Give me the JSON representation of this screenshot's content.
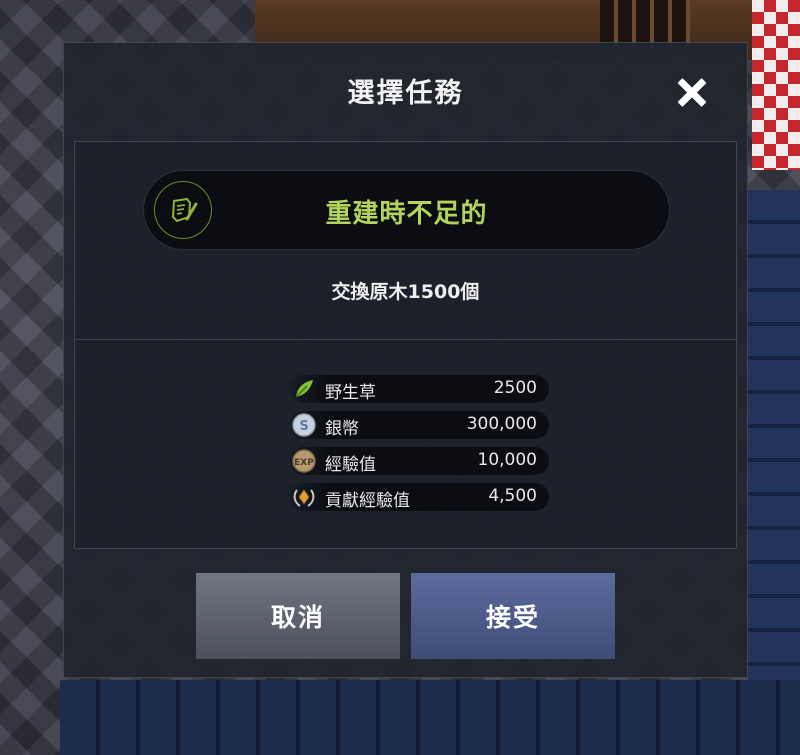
{
  "dialog": {
    "title": "選擇任務",
    "close_icon": "close-icon"
  },
  "quest": {
    "icon": "quest-scroll-icon",
    "name": "重建時不足的",
    "description": "交換原木1500個"
  },
  "rewards": [
    {
      "icon": "herb-leaf-icon",
      "name": "野生草",
      "amount": "2500"
    },
    {
      "icon": "silver-coin-icon",
      "name": "銀幣",
      "amount": "300,000"
    },
    {
      "icon": "exp-icon",
      "name": "經驗值",
      "amount": "10,000"
    },
    {
      "icon": "contribution-laurel-icon",
      "name": "貢獻經驗值",
      "amount": "4,500"
    }
  ],
  "buttons": {
    "cancel_label": "取消",
    "accept_label": "接受"
  },
  "colors": {
    "quest_name": "#b3d45c",
    "accept_button": "#4f5d8a",
    "cancel_button": "#5e636e"
  }
}
